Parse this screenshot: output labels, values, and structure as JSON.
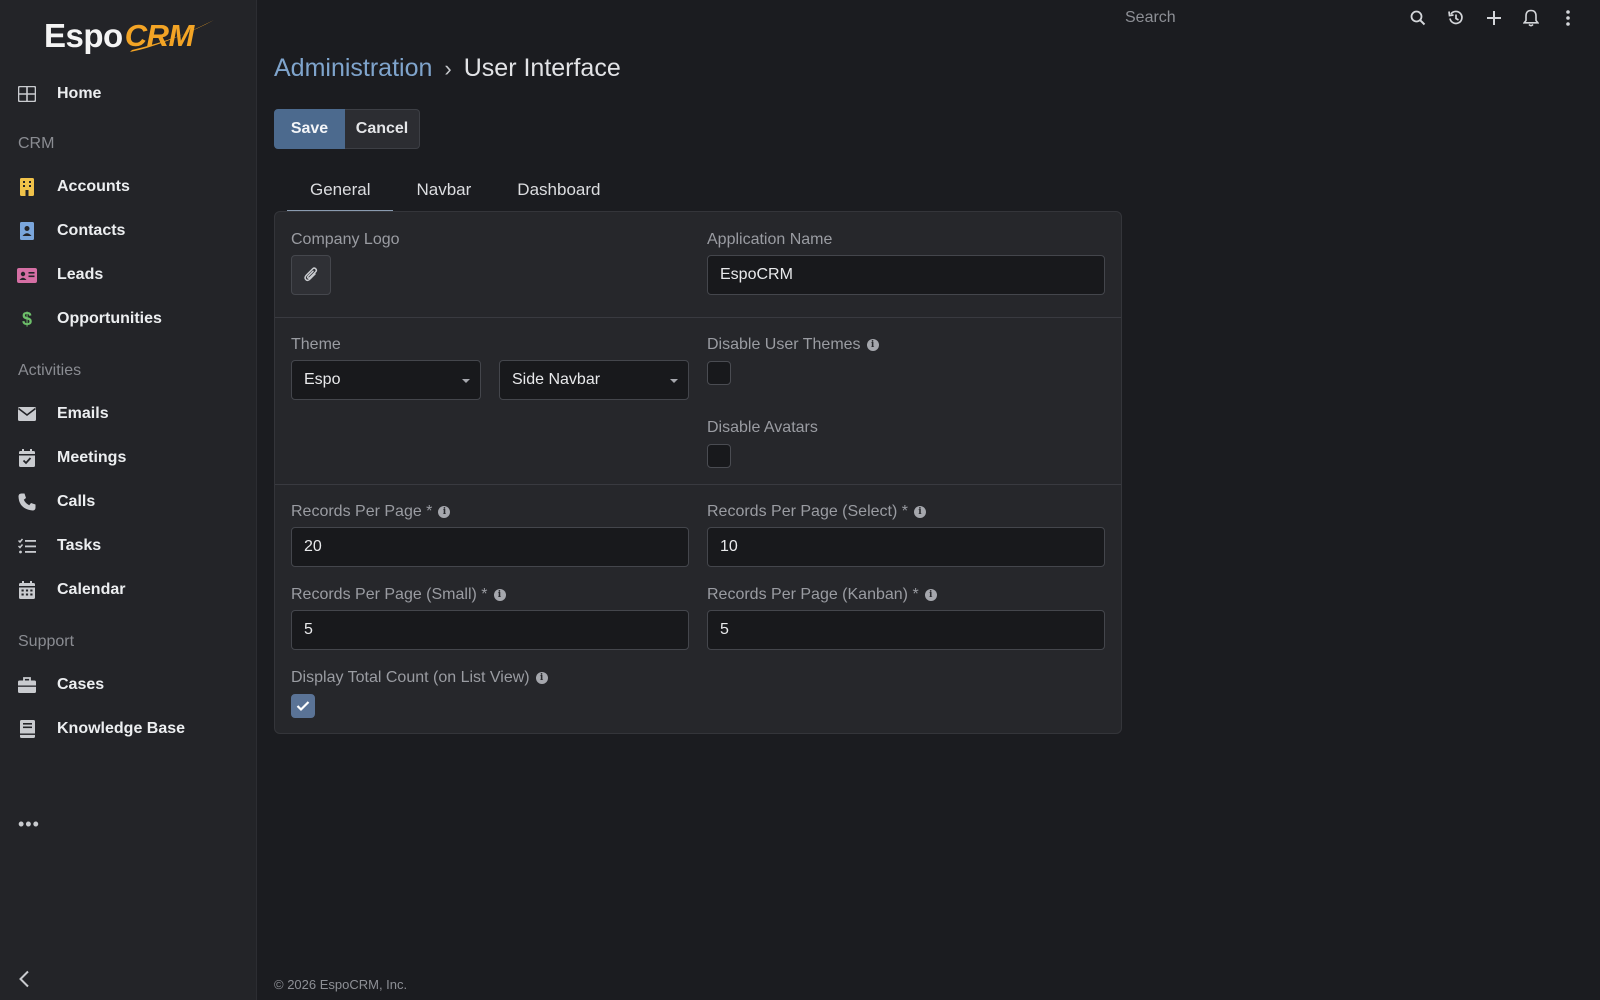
{
  "app": {
    "logo_text_1": "Espo",
    "logo_text_2": "CRM"
  },
  "sidebar": {
    "home": "Home",
    "sections": {
      "crm": "CRM",
      "activities": "Activities",
      "support": "Support"
    },
    "crm_items": [
      "Accounts",
      "Contacts",
      "Leads",
      "Opportunities"
    ],
    "activity_items": [
      "Emails",
      "Meetings",
      "Calls",
      "Tasks",
      "Calendar"
    ],
    "support_items": [
      "Cases",
      "Knowledge Base"
    ],
    "more": "•••",
    "colors": {
      "accounts": "#f0c24a",
      "contacts": "#7aa6dc",
      "leads": "#d56fa4",
      "opportunities": "#6dbf6a"
    }
  },
  "topbar": {
    "search_placeholder": "Search"
  },
  "header": {
    "breadcrumb_parent": "Administration",
    "breadcrumb_sep": "›",
    "breadcrumb_current": "User Interface"
  },
  "actions": {
    "save": "Save",
    "cancel": "Cancel"
  },
  "tabs": [
    "General",
    "Navbar",
    "Dashboard"
  ],
  "form": {
    "company_logo_label": "Company Logo",
    "application_name_label": "Application Name",
    "application_name_value": "EspoCRM",
    "theme_label": "Theme",
    "theme_value": "Espo",
    "navbar_value": "Side Navbar",
    "disable_user_themes_label": "Disable User Themes",
    "disable_user_themes_checked": false,
    "disable_avatars_label": "Disable Avatars",
    "disable_avatars_checked": false,
    "records_per_page_label": "Records Per Page *",
    "records_per_page_value": "20",
    "records_per_page_select_label": "Records Per Page (Select) *",
    "records_per_page_select_value": "10",
    "records_per_page_small_label": "Records Per Page (Small) *",
    "records_per_page_small_value": "5",
    "records_per_page_kanban_label": "Records Per Page (Kanban) *",
    "records_per_page_kanban_value": "5",
    "display_total_count_label": "Display Total Count (on List View)",
    "display_total_count_checked": true
  },
  "footer": {
    "copyright": "© 2026 EspoCRM, Inc."
  }
}
